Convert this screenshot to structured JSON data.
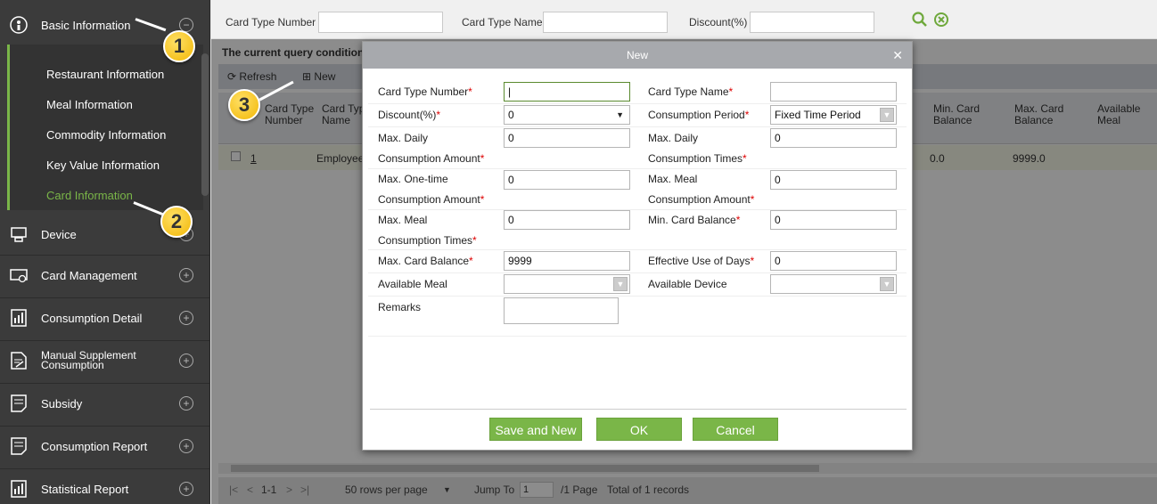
{
  "sidebar": {
    "basic_information": "Basic Information",
    "sub_items": [
      "Restaurant Information",
      "Meal Information",
      "Commodity Information",
      "Key Value Information",
      "Card Information"
    ],
    "menu": [
      {
        "label": "Device",
        "icon": "device-icon"
      },
      {
        "label": "Card Management",
        "icon": "card-management-icon"
      },
      {
        "label": "Consumption Detail",
        "icon": "report-icon"
      },
      {
        "label": "Manual Supplement\nConsumption",
        "icon": "manual-supplement-icon"
      },
      {
        "label": "Subsidy",
        "icon": "document-icon"
      },
      {
        "label": "Consumption Report",
        "icon": "document-icon"
      },
      {
        "label": "Statistical Report",
        "icon": "report-icon"
      }
    ]
  },
  "callouts": [
    "1",
    "2",
    "3"
  ],
  "search": {
    "card_type_number": "Card Type Number",
    "card_type_name": "Card Type Name",
    "discount": "Discount(%)"
  },
  "query_conditions": "The current query conditions",
  "toolbar": {
    "refresh": "Refresh",
    "new": "New"
  },
  "grid": {
    "headers": [
      "Card Type\nNumber",
      "Card Typ\nName",
      "Min. Card\nBalance",
      "Max. Card\nBalance",
      "Available\nMeal"
    ],
    "row": {
      "no": "1",
      "name": "Employee",
      "min_balance": "0.0",
      "max_balance": "9999.0"
    }
  },
  "pager": {
    "range": "1-1",
    "rows_per_page": "50 rows per page",
    "jump_to": "Jump To",
    "page_value": "1",
    "page_total": "/1 Page",
    "total": "Total of 1 records"
  },
  "dialog": {
    "title": "New",
    "fields": {
      "card_type_number": {
        "label": "Card Type Number",
        "value": ""
      },
      "card_type_name": {
        "label": "Card Type Name",
        "value": ""
      },
      "discount": {
        "label": "Discount(%)",
        "value": "0"
      },
      "consumption_period": {
        "label": "Consumption Period",
        "value": "Fixed Time Period"
      },
      "max_daily_amount": {
        "label1": "Max. Daily",
        "label2": "Consumption Amount",
        "value": "0"
      },
      "max_daily_times": {
        "label1": "Max. Daily",
        "label2": "Consumption Times",
        "value": "0"
      },
      "max_onetime_amount": {
        "label1": "Max. One-time",
        "label2": "Consumption Amount",
        "value": "0"
      },
      "max_meal_amount": {
        "label1": "Max. Meal",
        "label2": "Consumption Amount",
        "value": "0"
      },
      "max_meal_times": {
        "label1": "Max. Meal",
        "label2": "Consumption Times",
        "value": "0"
      },
      "min_card_balance": {
        "label": "Min. Card Balance",
        "value": "0"
      },
      "max_card_balance": {
        "label": "Max. Card Balance",
        "value": "9999"
      },
      "effective_days": {
        "label": "Effective Use of Days",
        "value": "0"
      },
      "available_meal": {
        "label": "Available Meal",
        "value": ""
      },
      "available_device": {
        "label": "Available Device",
        "value": ""
      },
      "remarks": {
        "label": "Remarks",
        "value": ""
      }
    },
    "buttons": {
      "save_and_new": "Save and New",
      "ok": "OK",
      "cancel": "Cancel"
    }
  },
  "colors": {
    "accent": "#7ab648",
    "sidebar_bg": "#3b3b3b",
    "required": "#dd0000",
    "callout": "#f2b705"
  }
}
